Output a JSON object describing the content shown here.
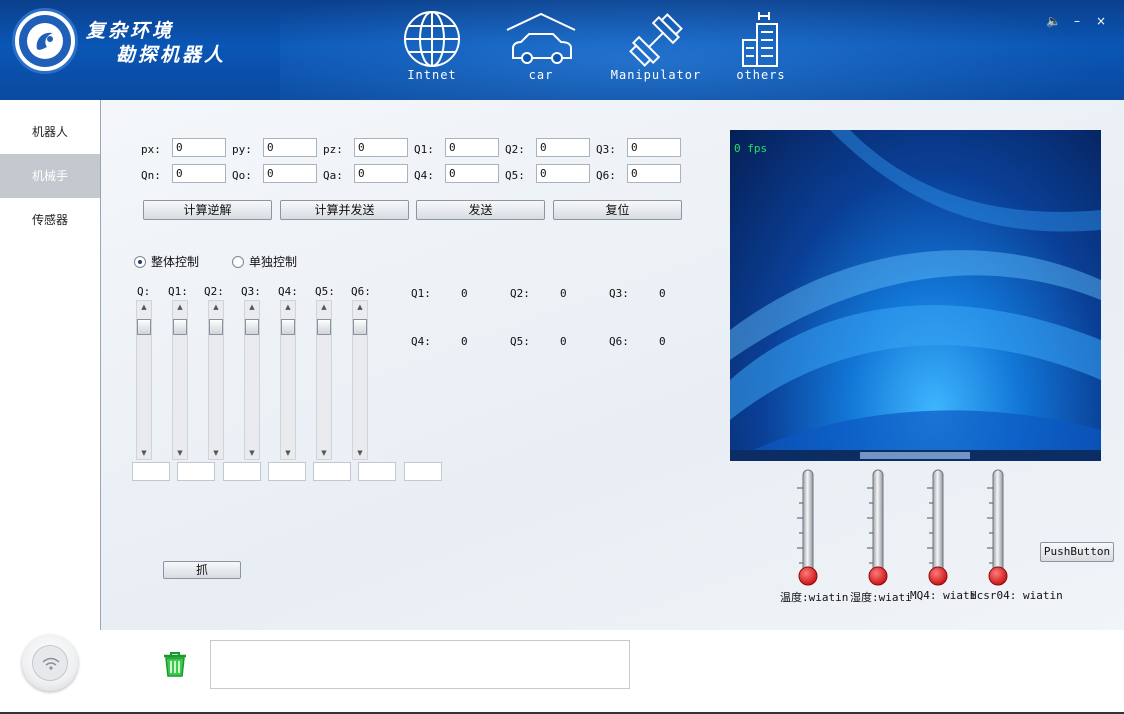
{
  "header": {
    "title_line1": "复杂环境",
    "title_line2": "勘探机器人",
    "nav": [
      {
        "label": "Intnet",
        "icon": "globe-icon"
      },
      {
        "label": "car",
        "icon": "car-icon"
      },
      {
        "label": "Manipulator",
        "icon": "dumbbell-icon"
      },
      {
        "label": "others",
        "icon": "building-icon"
      }
    ],
    "window_controls": {
      "speaker": "🔈",
      "minimize": "–",
      "close": "×"
    }
  },
  "sidebar": {
    "items": [
      {
        "label": "机器人",
        "active": false
      },
      {
        "label": "机械手",
        "active": true
      },
      {
        "label": "传感器",
        "active": false
      }
    ]
  },
  "coords": {
    "row1": [
      {
        "label": "px:",
        "value": "0"
      },
      {
        "label": "py:",
        "value": "0"
      },
      {
        "label": "pz:",
        "value": "0"
      },
      {
        "label": "Q1:",
        "value": "0"
      },
      {
        "label": "Q2:",
        "value": "0"
      },
      {
        "label": "Q3:",
        "value": "0"
      }
    ],
    "row2": [
      {
        "label": "Qn:",
        "value": "0"
      },
      {
        "label": "Qo:",
        "value": "0"
      },
      {
        "label": "Qa:",
        "value": "0"
      },
      {
        "label": "Q4:",
        "value": "0"
      },
      {
        "label": "Q5:",
        "value": "0"
      },
      {
        "label": "Q6:",
        "value": "0"
      }
    ]
  },
  "actions": {
    "inverse": "计算逆解",
    "compute_send": "计算并发送",
    "send": "发送",
    "reset": "复位"
  },
  "mode": {
    "whole": "整体控制",
    "single": "单独控制",
    "selected": "whole"
  },
  "sliders": {
    "labels": [
      "Q:",
      "Q1:",
      "Q2:",
      "Q3:",
      "Q4:",
      "Q5:",
      "Q6:"
    ]
  },
  "readouts": [
    {
      "label": "Q1:",
      "value": "0"
    },
    {
      "label": "Q2:",
      "value": "0"
    },
    {
      "label": "Q3:",
      "value": "0"
    },
    {
      "label": "Q4:",
      "value": "0"
    },
    {
      "label": "Q5:",
      "value": "0"
    },
    {
      "label": "Q6:",
      "value": "0"
    }
  ],
  "grab_button": "抓",
  "video": {
    "fps_text": "0  fps"
  },
  "push_button": "PushButton",
  "sensors": {
    "temperature": "温度:wiatin",
    "humidity": "湿度:wiati",
    "mq4": "MQ4: wiati",
    "hcsr04": "Hcsr04: wiatin"
  },
  "colors": {
    "header_blue": "#0a56b5",
    "thermometer_bulb": "#e21a1a",
    "fps_green": "#21e35a",
    "active_sidebar": "#c4c9cf"
  }
}
